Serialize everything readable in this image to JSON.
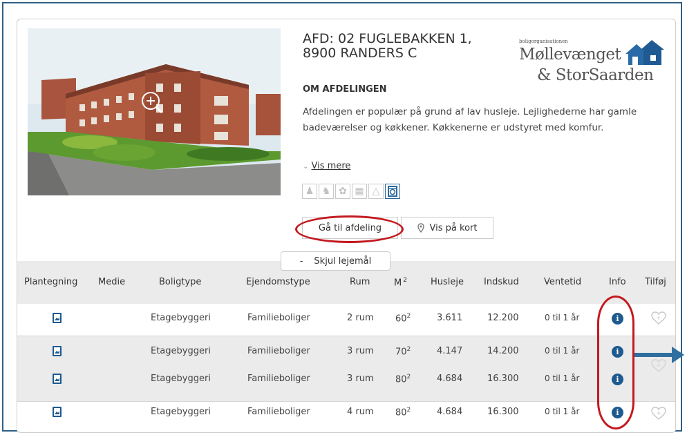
{
  "department": {
    "title_line1": "AFD: 02 FUGLEBAKKEN 1,",
    "title_line2": "8900 RANDERS C",
    "logo": {
      "small": "boligorganisationen",
      "line1": "Møllevænget",
      "line2": "& StorSaarden",
      "icon": "house-icon"
    },
    "about_heading": "OM AFDELINGEN",
    "description": "Afdelingen er populær på grund af lav husleje. Lejlighederne har gamle badeværelser og køkkener. Køkkenerne er udstyret med komfur.",
    "vis_mere": "Vis mere",
    "facility_icons": [
      "dog-icon",
      "cat-icon",
      "flower-icon",
      "fence-icon",
      "playground-icon",
      "washing-machine-icon"
    ],
    "goto_button": "Gå til afdeling",
    "map_button": "Vis på kort",
    "hide_button": "Skjul lejemål"
  },
  "table": {
    "headers": [
      "Plantegning",
      "Medie",
      "Boligtype",
      "Ejendomstype",
      "Rum",
      "M",
      "Husleje",
      "Indskud",
      "Ventetid",
      "Info",
      "Tilføj"
    ],
    "m_superscript": "2",
    "rows": [
      {
        "boligtype": "Etagebyggeri",
        "ejendomstype": "Familieboliger",
        "rum": "2 rum",
        "m2": "60",
        "sup": "2",
        "husleje": "3.611",
        "indskud": "12.200",
        "ventetid": "0 til 1 år"
      },
      {
        "boligtype": "Etagebyggeri",
        "ejendomstype": "Familieboliger",
        "rum": "3 rum",
        "m2": "70",
        "sup": "2",
        "husleje": "4.147",
        "indskud": "14.200",
        "ventetid": "0 til 1 år"
      },
      {
        "boligtype": "Etagebyggeri",
        "ejendomstype": "Familieboliger",
        "rum": "3 rum",
        "m2": "80",
        "sup": "2",
        "husleje": "4.684",
        "indskud": "16.300",
        "ventetid": "0 til 1 år"
      },
      {
        "boligtype": "Etagebyggeri",
        "ejendomstype": "Familieboliger",
        "rum": "4 rum",
        "m2": "80",
        "sup": "2",
        "husleje": "4.684",
        "indskud": "16.300",
        "ventetid": "0 til 1 år"
      }
    ],
    "info_glyph": "i"
  },
  "colors": {
    "frame": "#2f5f86",
    "annotation": "#c3191f",
    "info": "#1e5a8e",
    "row_alt": "#ebebeb"
  }
}
